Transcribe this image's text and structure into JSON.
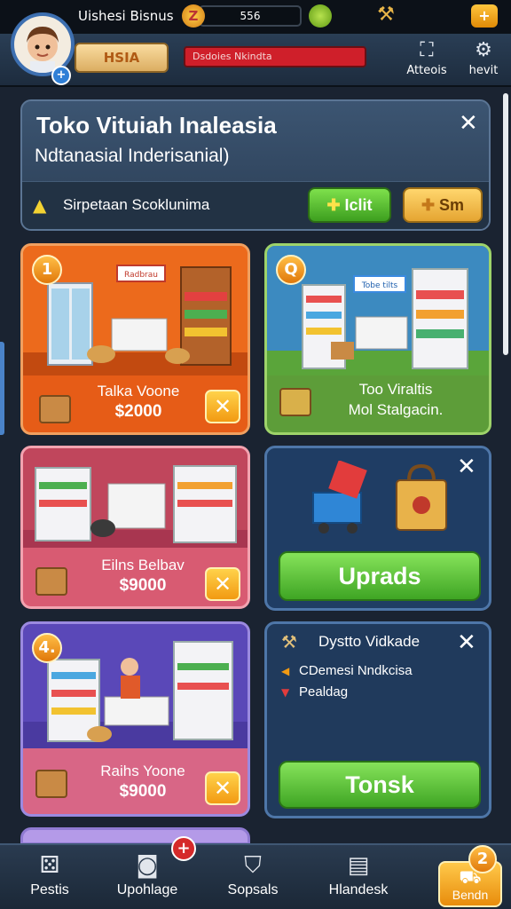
{
  "header": {
    "player_name": "Uishesi Bisnus",
    "coin_value": "556",
    "level_label": "HSIA",
    "red_bar_text": "Dsdoies Nkindta",
    "actions_label": "Atteois",
    "settings_label": "hevit",
    "coin_icon": "Z",
    "plus_icon": "+",
    "avatar_badge": "+"
  },
  "banner": {
    "title": "Toko Vituiah Inaleasia",
    "subtitle": "Ndtanasial Inderisanial)",
    "warning": "Sirpetaan Scoklunima",
    "edit_button": "Iclit",
    "small_button": "Sm",
    "close": "✕"
  },
  "cards": [
    {
      "number": "1",
      "label": "Talka Voone",
      "price": "$2000",
      "sign": "Radbrau",
      "close": "✕"
    },
    {
      "number": "Q",
      "label_line1": "Too Viraltis",
      "label_line2": "Mol Stalgacin.",
      "sign": "Tobe tilts"
    },
    {
      "label": "Eilns Belbav",
      "price": "$9000",
      "close": "✕"
    },
    {
      "button": "Uprads",
      "close": "✕"
    },
    {
      "number": "4.",
      "label": "Raihs Yoone",
      "price": "$9000",
      "close": "✕"
    },
    {
      "title": "Dystto Vidkade",
      "line1": "CDemesi Nndkcisa",
      "line2": "Pealdag",
      "button": "Tonsk",
      "close": "✕"
    }
  ],
  "nav": [
    {
      "label": "Pestis",
      "icon": "dice-icon"
    },
    {
      "label": "Upohlage",
      "icon": "camera-icon",
      "badge": "+"
    },
    {
      "label": "Sopsals",
      "icon": "shield-icon"
    },
    {
      "label": "Hlandesk",
      "icon": "book-icon"
    },
    {
      "label": "Bendn",
      "icon": "cart-icon",
      "badge": "2"
    }
  ],
  "colors": {
    "accent": "#f29a12",
    "green": "#3fa524",
    "panel": "#2b3e55"
  }
}
